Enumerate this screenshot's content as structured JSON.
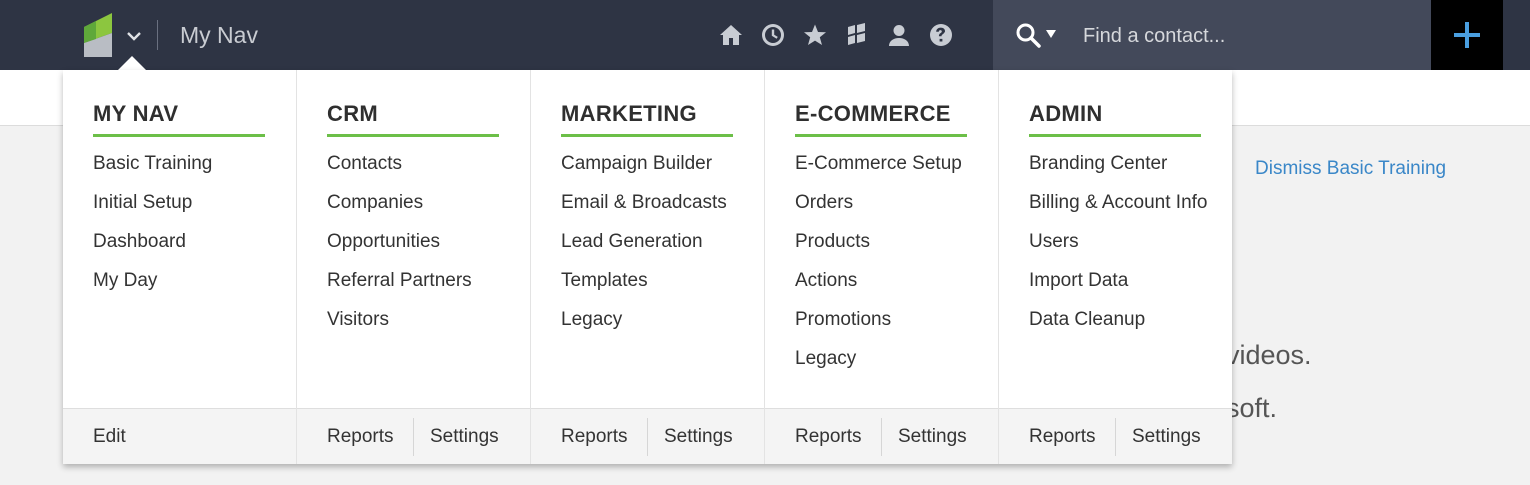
{
  "header": {
    "nav_title": "My Nav",
    "icons": [
      "home-icon",
      "clock-icon",
      "star-icon",
      "apps-icon",
      "user-icon",
      "help-icon"
    ],
    "search_placeholder": "Find a contact...",
    "accent": "#6cbf48",
    "add_button_color": "#4a9fe0"
  },
  "menu": {
    "columns": [
      {
        "heading": "MY NAV",
        "items": [
          "Basic Training",
          "Initial Setup",
          "Dashboard",
          "My Day"
        ],
        "footer": [
          "Edit"
        ]
      },
      {
        "heading": "CRM",
        "items": [
          "Contacts",
          "Companies",
          "Opportunities",
          "Referral Partners",
          "Visitors"
        ],
        "footer": [
          "Reports",
          "Settings"
        ]
      },
      {
        "heading": "MARKETING",
        "items": [
          "Campaign Builder",
          "Email & Broadcasts",
          "Lead Generation",
          "Templates",
          "Legacy"
        ],
        "footer": [
          "Reports",
          "Settings"
        ]
      },
      {
        "heading": "E-COMMERCE",
        "items": [
          "E-Commerce Setup",
          "Orders",
          "Products",
          "Actions",
          "Promotions",
          "Legacy"
        ],
        "footer": [
          "Reports",
          "Settings"
        ]
      },
      {
        "heading": "ADMIN",
        "items": [
          "Branding Center",
          "Billing & Account Info",
          "Users",
          "Import Data",
          "Data Cleanup"
        ],
        "footer": [
          "Reports",
          "Settings"
        ]
      }
    ]
  },
  "page": {
    "dismiss_link": "Dismiss Basic Training",
    "partial_text_1": "videos.",
    "partial_text_2": "soft."
  }
}
